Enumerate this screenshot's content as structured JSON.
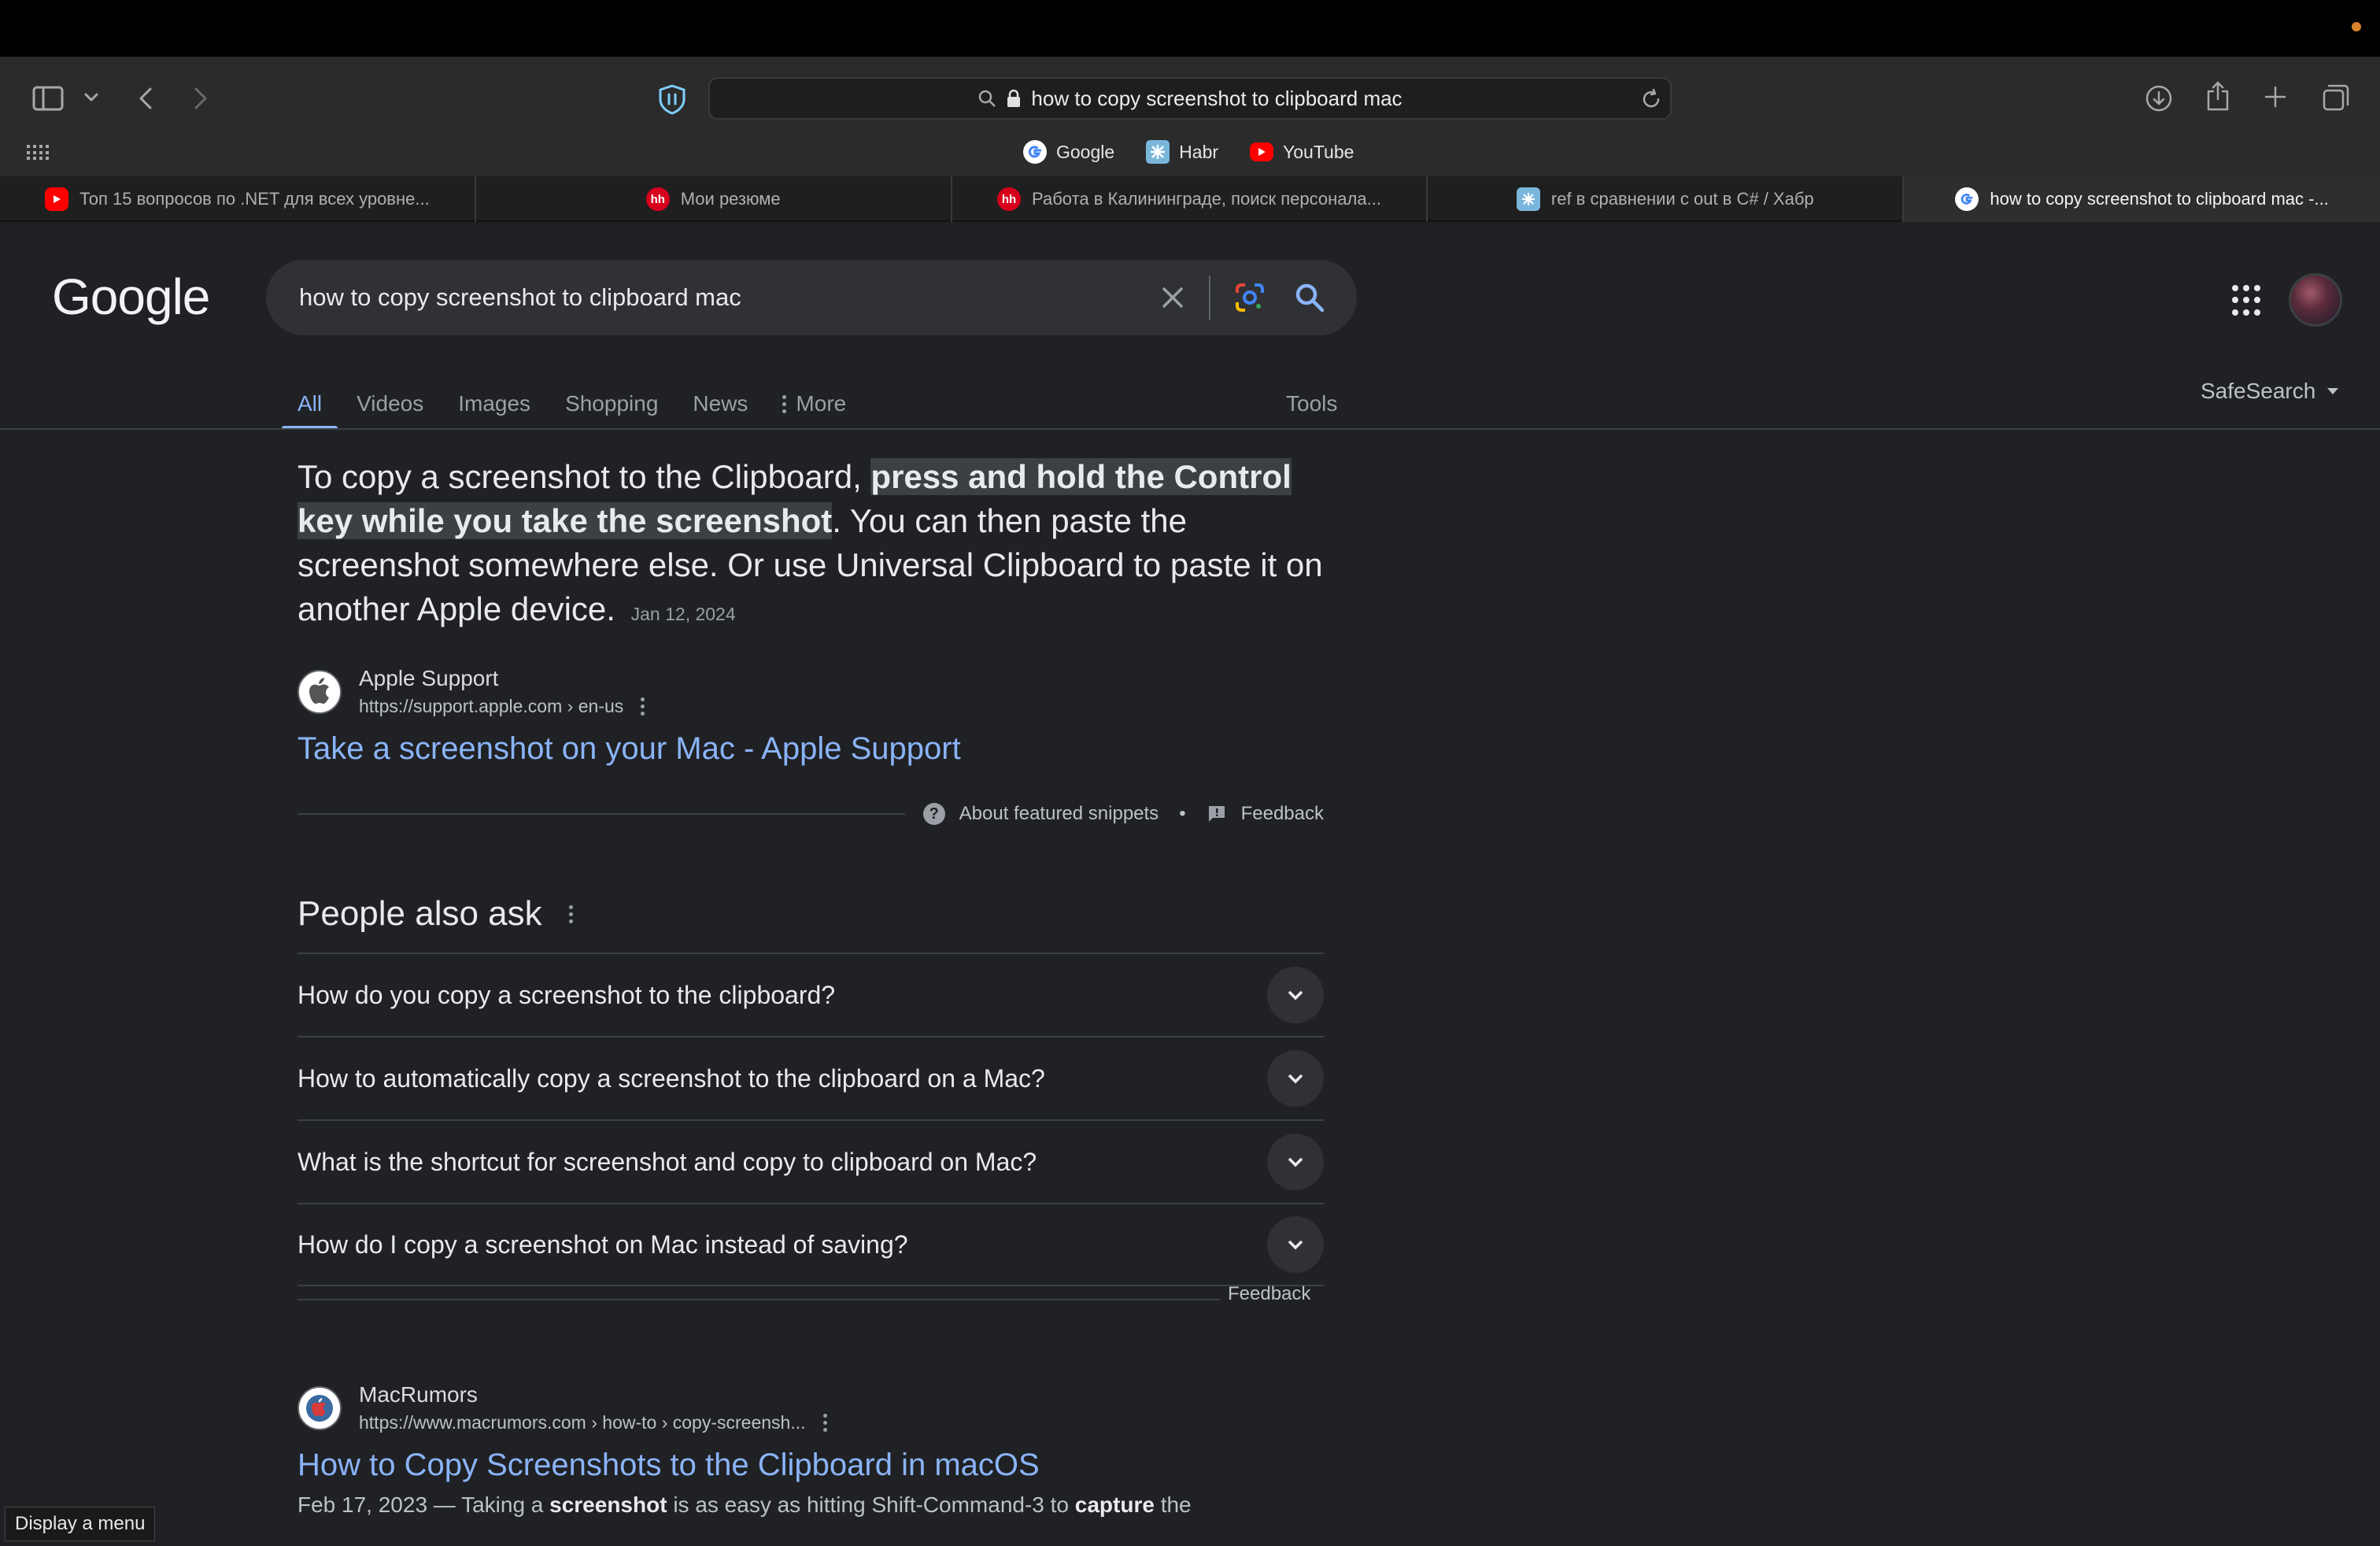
{
  "browser": {
    "url_text": "how to copy screenshot to clipboard mac",
    "favorites": [
      {
        "label": "Google"
      },
      {
        "label": "Habr"
      },
      {
        "label": "YouTube"
      }
    ],
    "tabs": [
      {
        "label": "Топ 15 вопросов по .NET для всех уровне...",
        "icon": "youtube-icon"
      },
      {
        "label": "Мои резюме",
        "icon": "hh-icon"
      },
      {
        "label": "Работа в Калининграде, поиск персонала...",
        "icon": "hh-icon"
      },
      {
        "label": "ref в сравнении с out в C# / Хабр",
        "icon": "habr-icon"
      },
      {
        "label": "how to copy screenshot to clipboard mac -...",
        "icon": "google-icon"
      }
    ]
  },
  "google": {
    "logo": "Google",
    "query": "how to copy screenshot to clipboard mac",
    "nav": {
      "all": "All",
      "videos": "Videos",
      "images": "Images",
      "shopping": "Shopping",
      "news": "News",
      "more": "More",
      "tools": "Tools",
      "safesearch": "SafeSearch"
    },
    "snippet": {
      "lead": "To copy a screenshot to the Clipboard, ",
      "highlight": "press and hold the Control key while you take the screenshot",
      "rest": ". You can then paste the screenshot somewhere else. Or use Universal Clipboard to paste it on another Apple device.",
      "date": "Jan 12, 2024",
      "source_name": "Apple Support",
      "source_url": "https://support.apple.com › en-us",
      "link_title": "Take a screenshot on your Mac - Apple Support",
      "about": "About featured snippets",
      "separator": "•",
      "feedback": "Feedback"
    },
    "people_also_ask": {
      "title": "People also ask",
      "questions": [
        "How do you copy a screenshot to the clipboard?",
        "How to automatically copy a screenshot to the clipboard on a Mac?",
        "What is the shortcut for screenshot and copy to clipboard on Mac?",
        "How do I copy a screenshot on Mac instead of saving?"
      ],
      "feedback": "Feedback"
    },
    "result2": {
      "source_name": "MacRumors",
      "source_url": "https://www.macrumors.com › how-to › copy-screensh...",
      "title": "How to Copy Screenshots to the Clipboard in macOS",
      "desc_1": "Feb 17, 2023 — Taking a ",
      "desc_b1": "screenshot",
      "desc_2": " is as easy as hitting Shift-Command-3 to ",
      "desc_b2": "capture",
      "desc_3": " the"
    }
  },
  "tooltip": "Display a menu",
  "colors": {
    "page_bg": "#202124",
    "link": "#8ab4f8",
    "toolbar": "#2b2b2b"
  }
}
